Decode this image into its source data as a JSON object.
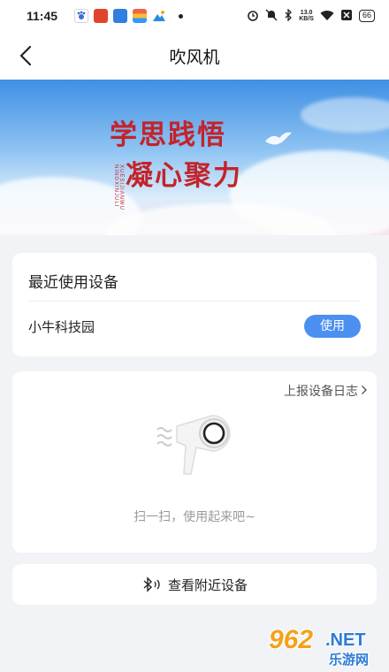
{
  "status_bar": {
    "time": "11:45",
    "net_speed_top": "13.0",
    "net_speed_bottom": "KB/S",
    "battery": "66",
    "icons": [
      "app-paw-icon",
      "app-red-icon",
      "app-blue-icon",
      "app-flag-icon",
      "app-mountain-icon",
      "alarm-icon",
      "mute-icon",
      "bluetooth-icon",
      "wifi-icon",
      "sim-off-icon",
      "battery-icon"
    ]
  },
  "header": {
    "title": "吹风机",
    "back_icon": "chevron-left-icon"
  },
  "banner": {
    "line1": "学思践悟",
    "line2": "凝心聚力",
    "pinyin": "XUESIJIANWU NINGXINJULI"
  },
  "recent": {
    "title": "最近使用设备",
    "device_name": "小牛科技园",
    "use_label": "使用"
  },
  "scan": {
    "log_link": "上报设备日志",
    "log_icon": "chevron-right-icon",
    "hint": "扫一扫，使用起来吧~",
    "illustration": "hair-dryer-icon"
  },
  "nearby": {
    "label": "查看附近设备",
    "icon": "bluetooth-icon"
  },
  "watermark": {
    "number": "962",
    "suffix": ".NET",
    "site": "乐游网"
  },
  "colors": {
    "accent": "#4b8ff0",
    "banner_text": "#c4232b",
    "background": "#f2f3f7"
  }
}
